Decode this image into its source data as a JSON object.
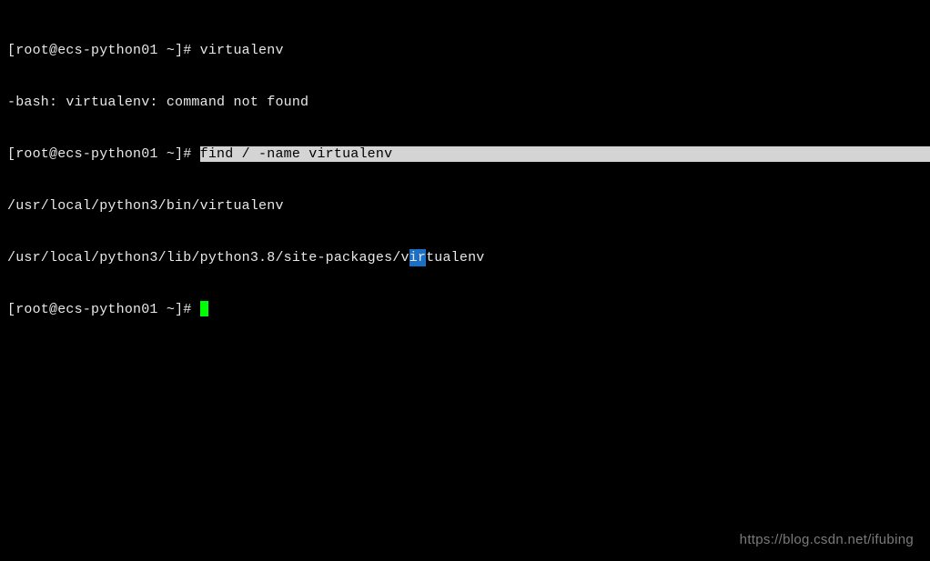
{
  "terminal": {
    "lines": {
      "l1_prompt": "[root@ecs-python01 ~]# ",
      "l1_cmd": "virtualenv",
      "l2": "-bash: virtualenv: command not found",
      "l3_prompt": "[root@ecs-python01 ~]# ",
      "l3_cmd_highlighted": "find / -name virtualenv",
      "l4": "/usr/local/python3/bin/virtualenv",
      "l5_before": "/usr/local/python3/lib/python3.8/site-packages/v",
      "l5_badge": "ir",
      "l5_after": "tualenv",
      "l6_prompt": "[root@ecs-python01 ~]# "
    }
  },
  "watermark": "https://blog.csdn.net/ifubing"
}
